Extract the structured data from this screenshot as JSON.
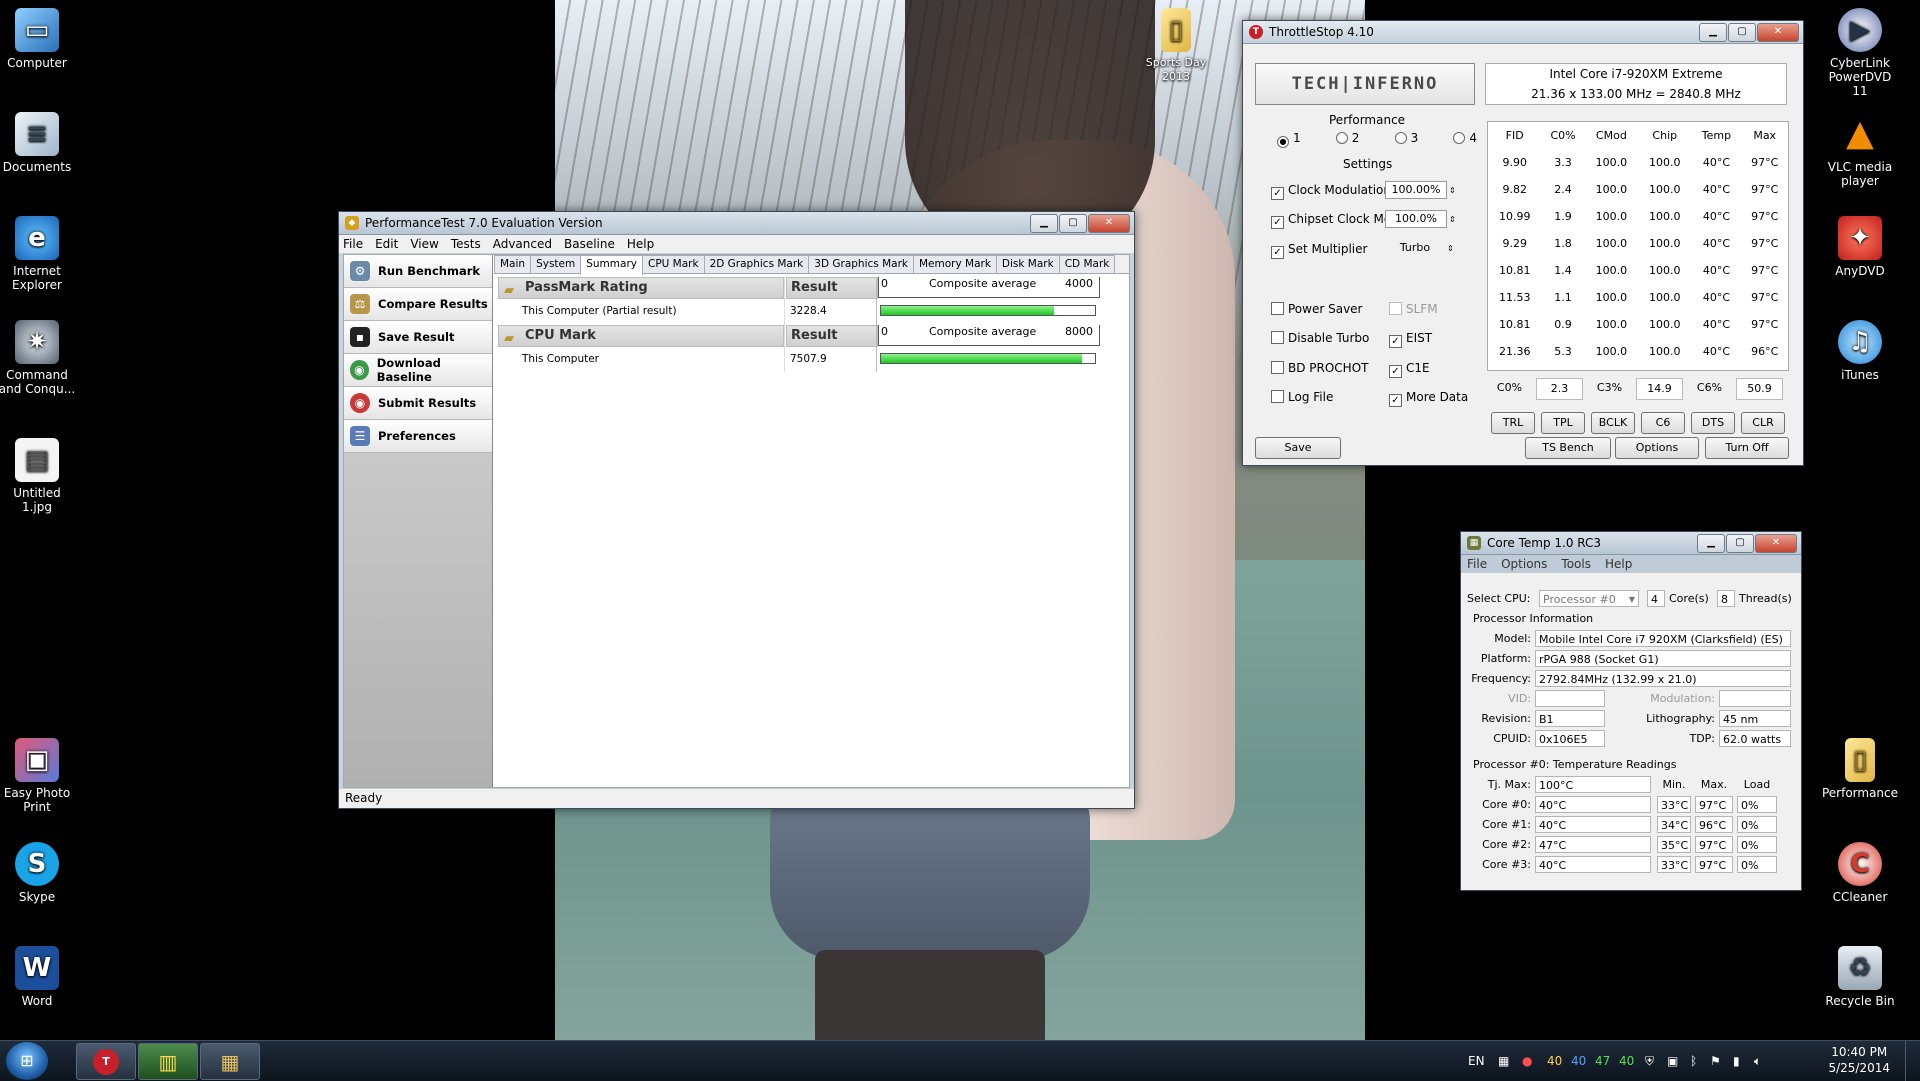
{
  "desktop": {
    "left_icons": [
      "Computer",
      "Documents",
      "Internet Explorer",
      "Command and Conqu...",
      "Untitled 1.jpg",
      "Easy Photo Print",
      "Skype",
      "Word"
    ],
    "right_icons": [
      "CyberLink PowerDVD 11",
      "VLC media player",
      "AnyDVD",
      "iTunes",
      "Performance",
      "CCleaner",
      "Recycle Bin"
    ],
    "folder_icon": "Sports Day 2013"
  },
  "performance_test": {
    "title": "PerformanceTest 7.0 Evaluation Version",
    "menu": [
      "File",
      "Edit",
      "View",
      "Tests",
      "Advanced",
      "Baseline",
      "Help"
    ],
    "side_buttons": [
      "Run Benchmark",
      "Compare Results",
      "Save Result",
      "Download Baseline",
      "Submit Results",
      "Preferences"
    ],
    "tabs": [
      "Main",
      "System",
      "Summary",
      "CPU Mark",
      "2D Graphics Mark",
      "3D Graphics Mark",
      "Memory Mark",
      "Disk Mark",
      "CD Mark"
    ],
    "active_tab": "Summary",
    "rows": [
      {
        "name": "PassMark Rating",
        "result_header": "Result",
        "item": "This Computer (Partial result)",
        "value": "3228.4",
        "scale_min": "0",
        "scale_label": "Composite average",
        "scale_max": "4000",
        "fill_fraction": 0.81
      },
      {
        "name": "CPU Mark",
        "result_header": "Result",
        "item": "This Computer",
        "value": "7507.9",
        "scale_min": "0",
        "scale_label": "Composite average",
        "scale_max": "8000",
        "fill_fraction": 0.94
      }
    ],
    "status": "Ready"
  },
  "throttlestop": {
    "title": "ThrottleStop 4.10",
    "logo": "TECH|INFERNO",
    "cpu_line1": "Intel Core i7-920XM Extreme",
    "cpu_line2": "21.36 x 133.00 MHz = 2840.8 MHz",
    "performance_label": "Performance",
    "profiles": [
      "1",
      "2",
      "3",
      "4"
    ],
    "settings_label": "Settings",
    "settings": [
      {
        "label": "Clock Modulation",
        "checked": true,
        "value": "100.00%"
      },
      {
        "label": "Chipset Clock Mod",
        "checked": true,
        "value": "100.0%"
      },
      {
        "label": "Set Multiplier",
        "checked": true,
        "value": "Turbo"
      }
    ],
    "options_left": [
      {
        "label": "Power Saver",
        "checked": false
      },
      {
        "label": "Disable Turbo",
        "checked": false
      },
      {
        "label": "BD PROCHOT",
        "checked": false
      },
      {
        "label": "Log File",
        "checked": false
      }
    ],
    "options_right": [
      {
        "label": "SLFM",
        "checked": false,
        "disabled": true
      },
      {
        "label": "EIST",
        "checked": true
      },
      {
        "label": "C1E",
        "checked": true
      },
      {
        "label": "More Data",
        "checked": true
      }
    ],
    "table_headers": [
      "FID",
      "C0%",
      "CMod",
      "Chip",
      "Temp",
      "Max"
    ],
    "table_rows": [
      [
        "9.90",
        "3.3",
        "100.0",
        "100.0",
        "40°C",
        "97°C"
      ],
      [
        "9.82",
        "2.4",
        "100.0",
        "100.0",
        "40°C",
        "97°C"
      ],
      [
        "10.99",
        "1.9",
        "100.0",
        "100.0",
        "40°C",
        "97°C"
      ],
      [
        "9.29",
        "1.8",
        "100.0",
        "100.0",
        "40°C",
        "97°C"
      ],
      [
        "10.81",
        "1.4",
        "100.0",
        "100.0",
        "40°C",
        "97°C"
      ],
      [
        "11.53",
        "1.1",
        "100.0",
        "100.0",
        "40°C",
        "97°C"
      ],
      [
        "10.81",
        "0.9",
        "100.0",
        "100.0",
        "40°C",
        "97°C"
      ],
      [
        "21.36",
        "5.3",
        "100.0",
        "100.0",
        "40°C",
        "96°C"
      ]
    ],
    "cstates": [
      [
        "C0%",
        "2.3"
      ],
      [
        "C3%",
        "14.9"
      ],
      [
        "C6%",
        "50.9"
      ]
    ],
    "small_buttons": [
      "TRL",
      "TPL",
      "BCLK",
      "C6",
      "DTS",
      "CLR"
    ],
    "bottom_buttons": {
      "save": "Save",
      "bench": "TS Bench",
      "options": "Options",
      "off": "Turn Off"
    }
  },
  "coretemp": {
    "title": "Core Temp 1.0 RC3",
    "menu": [
      "File",
      "Options",
      "Tools",
      "Help"
    ],
    "select_cpu_label": "Select CPU:",
    "select_cpu_value": "Processor #0",
    "cores_value": "4",
    "cores_label": "Core(s)",
    "threads_value": "8",
    "threads_label": "Thread(s)",
    "proc_info_label": "Processor Information",
    "model_label": "Model:",
    "model": "Mobile Intel Core i7 920XM (Clarksfield)  (ES)",
    "platform_label": "Platform:",
    "platform": "rPGA 988 (Socket G1)",
    "frequency_label": "Frequency:",
    "frequency": "2792.84MHz (132.99 x 21.0)",
    "vid_label": "VID:",
    "modulation_label": "Modulation:",
    "revision_label": "Revision:",
    "revision": "B1",
    "litho_label": "Lithography:",
    "litho": "45 nm",
    "cpuid_label": "CPUID:",
    "cpuid": "0x106E5",
    "tdp_label": "TDP:",
    "tdp": "62.0 watts",
    "temps_label": "Processor #0: Temperature Readings",
    "tjmax_label": "Tj. Max:",
    "tjmax": "100°C",
    "col_min": "Min.",
    "col_max": "Max.",
    "col_load": "Load",
    "cores": [
      {
        "label": "Core #0:",
        "temp": "40°C",
        "min": "33°C",
        "max": "97°C",
        "load": "0%"
      },
      {
        "label": "Core #1:",
        "temp": "40°C",
        "min": "34°C",
        "max": "96°C",
        "load": "0%"
      },
      {
        "label": "Core #2:",
        "temp": "47°C",
        "min": "35°C",
        "max": "97°C",
        "load": "0%"
      },
      {
        "label": "Core #3:",
        "temp": "40°C",
        "min": "33°C",
        "max": "97°C",
        "load": "0%"
      }
    ]
  },
  "taskbar": {
    "lang": "EN",
    "tray_numbers": [
      "40",
      "40",
      "47",
      "40"
    ],
    "time": "10:40 PM",
    "date": "5/25/2014"
  }
}
